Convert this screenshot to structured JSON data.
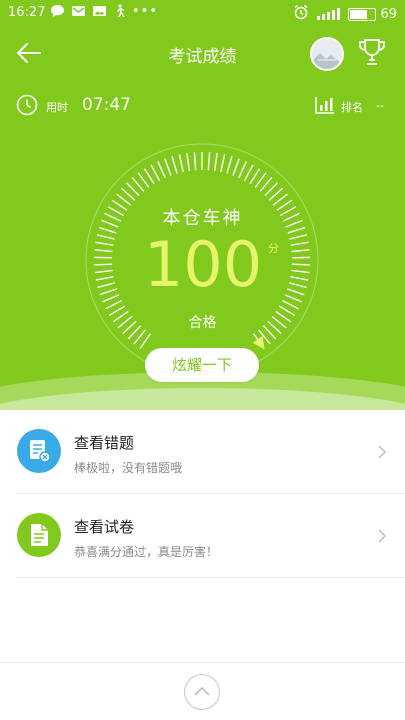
{
  "status_bar": {
    "time": "16:27",
    "battery": "69",
    "dots": "•••"
  },
  "nav": {
    "title": "考试成绩"
  },
  "info": {
    "time_label": "用时",
    "time_value": "07:47",
    "rank_label": "排名",
    "rank_value": "--"
  },
  "result": {
    "title": "本仓车神",
    "score": "100",
    "unit": "分",
    "status": "合格",
    "show_button": "炫耀一下",
    "gauge_fraction": 1.0
  },
  "list": [
    {
      "title": "查看错题",
      "subtitle": "棒极啦，没有错题哦"
    },
    {
      "title": "查看试卷",
      "subtitle": "恭喜满分通过，真是厉害！"
    }
  ],
  "colors": {
    "primary": "#82c91e",
    "score": "#e7f56a",
    "wrong_icon": "#3aa9e8",
    "paper_icon": "#82c91e"
  }
}
